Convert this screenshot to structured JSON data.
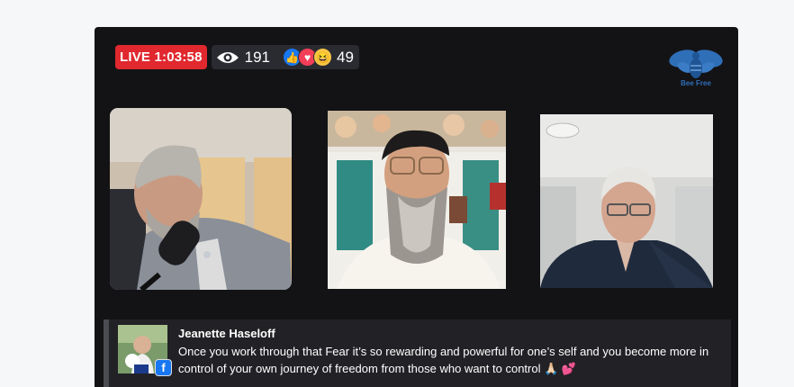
{
  "broadcast": {
    "live_label": "LIVE",
    "elapsed": "1:03:58",
    "viewer_count": "191",
    "reaction_count": "49",
    "reactions": [
      {
        "type": "like",
        "glyph": "👍"
      },
      {
        "type": "love",
        "glyph": "♥"
      },
      {
        "type": "haha",
        "glyph": "😆"
      }
    ]
  },
  "brand": {
    "logo_text": "Bee Free",
    "logo_icon": "bee-icon",
    "color": "#2f6fb8"
  },
  "comment": {
    "author": "Jeanette Haseloff",
    "text": "Once you work through that Fear it’s so rewarding and powerful for one’s self and you become more in control of your own journey of freedom from those who want to control 🙏🏻 💕",
    "platform_badge": "f"
  },
  "colors": {
    "live_red": "#e0282e",
    "stage_bg": "#131316",
    "facebook_blue": "#1877f2"
  }
}
